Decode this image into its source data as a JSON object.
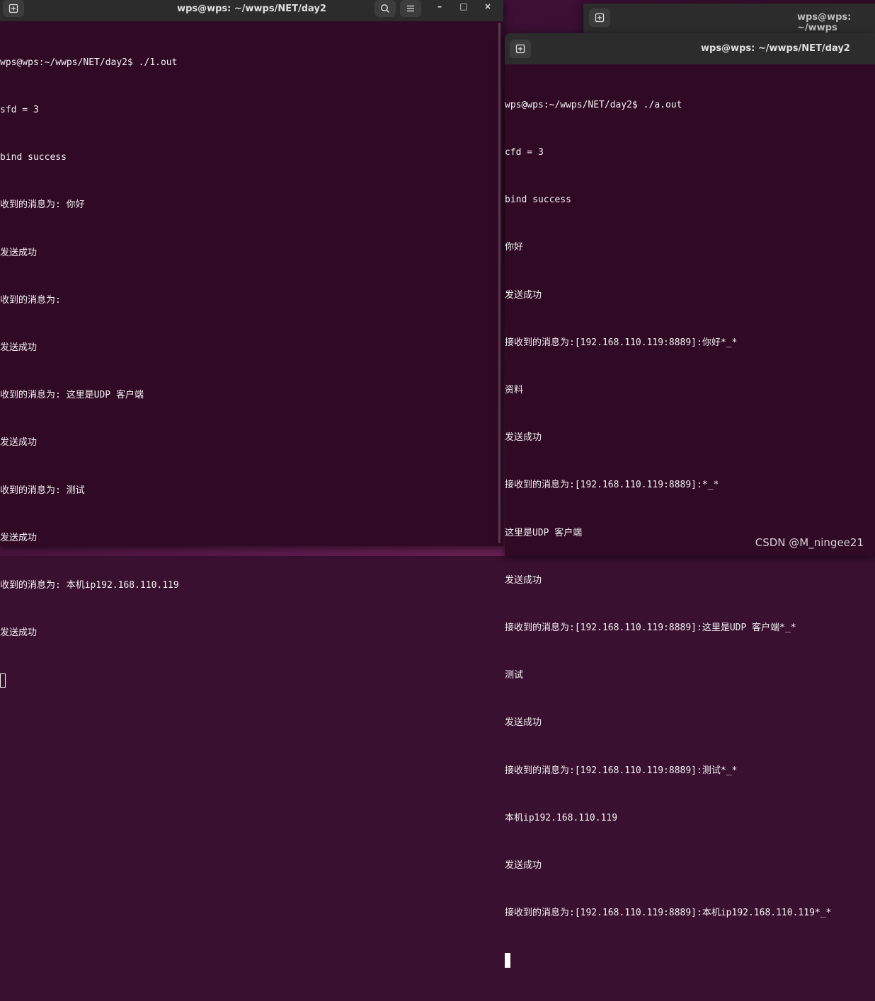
{
  "left_window": {
    "title": "wps@wps: ~/wwps/NET/day2",
    "controls": {
      "minimize": "–",
      "maximize": "□",
      "close": "×"
    },
    "lines": [
      "wps@wps:~/wwps/NET/day2$ ./1.out",
      "sfd = 3",
      "bind success",
      "收到的消息为: 你好",
      "发送成功",
      "收到的消息为:",
      "发送成功",
      "收到的消息为: 这里是UDP 客户端",
      "发送成功",
      "收到的消息为: 测试",
      "发送成功",
      "收到的消息为: 本机ip192.168.110.119",
      "发送成功"
    ]
  },
  "back_window": {
    "title": "wps@wps: ~/wwps"
  },
  "right_window": {
    "title": "wps@wps: ~/wwps/NET/day2",
    "lines": [
      "wps@wps:~/wwps/NET/day2$ ./a.out",
      "cfd = 3",
      "bind success",
      "你好",
      "发送成功",
      "接收到的消息为:[192.168.110.119:8889]:你好*_*",
      "资料",
      "发送成功",
      "接收到的消息为:[192.168.110.119:8889]:*_*",
      "这里是UDP 客户端",
      "发送成功",
      "接收到的消息为:[192.168.110.119:8889]:这里是UDP 客户端*_*",
      "测试",
      "发送成功",
      "接收到的消息为:[192.168.110.119:8889]:测试*_*",
      "本机ip192.168.110.119",
      "发送成功",
      "接收到的消息为:[192.168.110.119:8889]:本机ip192.168.110.119*_*"
    ]
  },
  "watermark": "CSDN @M_ningee21"
}
